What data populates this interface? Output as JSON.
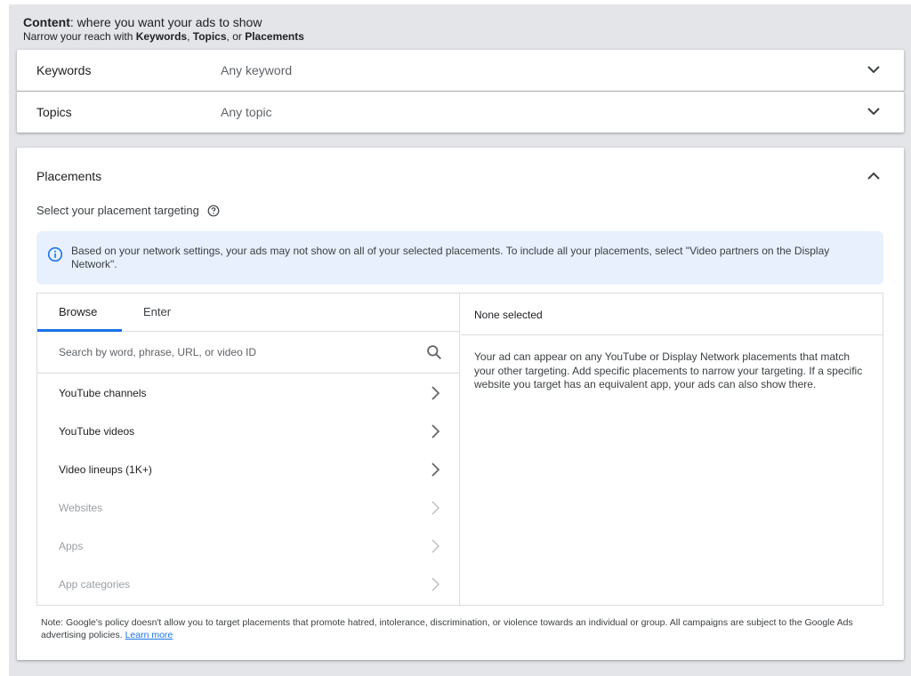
{
  "header": {
    "title_bold": "Content",
    "title_rest": ": where you want your ads to show",
    "subtitle_prefix": "Narrow your reach with ",
    "subtitle_keywords": "Keywords",
    "subtitle_sep1": ", ",
    "subtitle_topics": "Topics",
    "subtitle_sep2": ", or ",
    "subtitle_placements": "Placements"
  },
  "keywords": {
    "label": "Keywords",
    "value": "Any keyword"
  },
  "topics": {
    "label": "Topics",
    "value": "Any topic"
  },
  "placements": {
    "title": "Placements",
    "select_label": "Select your placement targeting",
    "info": "Based on your network settings, your ads may not show on all of your selected placements. To include all your placements, select \"Video partners on the Display Network\".",
    "tabs": [
      "Browse",
      "Enter"
    ],
    "search_placeholder": "Search by word, phrase, URL, or video ID",
    "items": [
      {
        "label": "YouTube channels",
        "disabled": false
      },
      {
        "label": "YouTube videos",
        "disabled": false
      },
      {
        "label": "Video lineups (1K+)",
        "disabled": false
      },
      {
        "label": "Websites",
        "disabled": true
      },
      {
        "label": "Apps",
        "disabled": true
      },
      {
        "label": "App categories",
        "disabled": true
      }
    ],
    "selected_header": "None selected",
    "selected_body": "Your ad can appear on any YouTube or Display Network placements that match your other targeting. Add specific placements to narrow your targeting. If a specific website you target has an equivalent app, your ads can also show there.",
    "note": "Note: Google's policy doesn't allow you to target placements that promote hatred, intolerance, discrimination, or violence towards an individual or group. All campaigns are subject to the Google Ads advertising policies.",
    "learn_more": "Learn more"
  },
  "colors": {
    "accent": "#1a73e8",
    "info_bg": "#e8f0fe",
    "page_bg": "#e4e5e8"
  }
}
